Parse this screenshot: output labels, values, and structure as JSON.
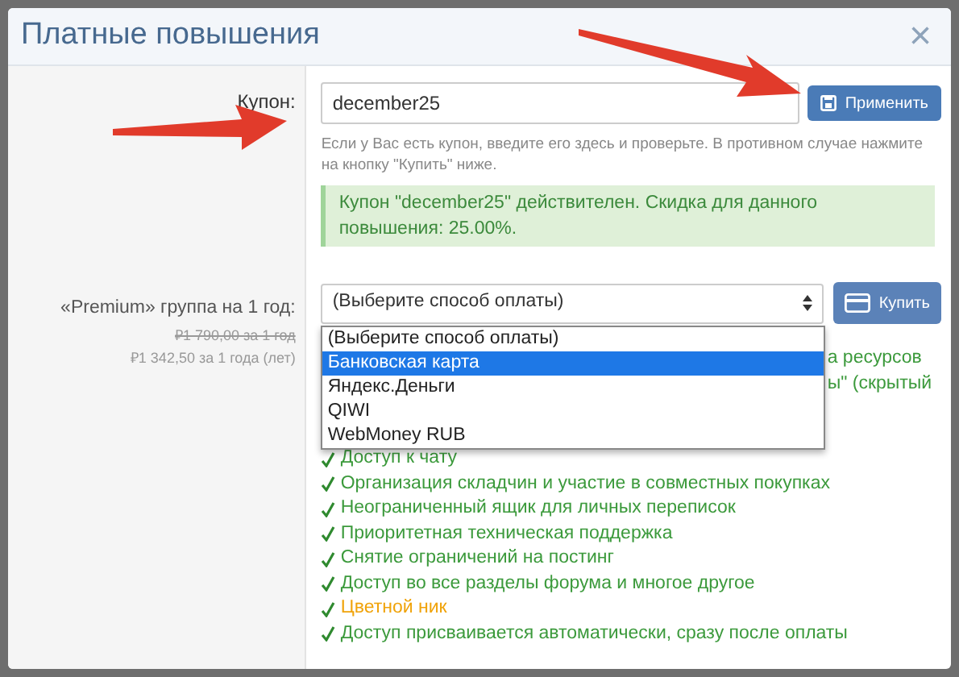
{
  "modal": {
    "title": "Платные повышения",
    "close": "×"
  },
  "coupon": {
    "label": "Купон:",
    "value": "december25",
    "apply_button": "Применить",
    "help": "Если у Вас есть купон, введите его здесь и проверьте. В противном случае нажмите на кнопку \"Купить\" ниже.",
    "alert": "Купон \"december25\" действителен. Скидка для данного повышения: 25.00%."
  },
  "upgrade": {
    "label": "«Premium» группа на 1 год:",
    "old_price": "₽1 790,00 за 1 год",
    "new_price": "₽1 342,50 за 1 года (лет)",
    "select_value": "(Выберите способ оплаты)",
    "buy_button": "Купить",
    "options": [
      {
        "label": "(Выберите способ оплаты)",
        "selected": false
      },
      {
        "label": "Банковская карта",
        "selected": true
      },
      {
        "label": "Яндекс.Деньги",
        "selected": false
      },
      {
        "label": "QIWI",
        "selected": false
      },
      {
        "label": "WebMoney RUB",
        "selected": false
      }
    ]
  },
  "features": [
    {
      "text": "а ресурсов",
      "kind": "partial",
      "color": "#3c9a3c"
    },
    {
      "text": "ы\" (скрытый",
      "kind": "partial",
      "color": "#3c9a3c"
    },
    {
      "kind": "hidden"
    },
    {
      "kind": "hidden"
    },
    {
      "text": "Доступ к чату",
      "kind": "item",
      "color": "#3c9a3c"
    },
    {
      "text": "Организация складчин и участие в совместных покупках",
      "kind": "item",
      "color": "#3c9a3c"
    },
    {
      "text": "Неограниченный ящик для личных переписок",
      "kind": "item",
      "color": "#3c9a3c"
    },
    {
      "text": "Приоритетная техническая поддержка",
      "kind": "item",
      "color": "#3c9a3c"
    },
    {
      "text": "Снятие ограничений на постинг",
      "kind": "item",
      "color": "#3c9a3c"
    },
    {
      "text": "Доступ во все разделы форума и многое другое",
      "kind": "item",
      "color": "#3c9a3c"
    },
    {
      "text": "Цветной ник",
      "kind": "item",
      "color": "#f0a30a"
    },
    {
      "text": "Доступ присваивается автоматически, сразу после оплаты",
      "kind": "item",
      "color": "#3c9a3c"
    }
  ]
}
